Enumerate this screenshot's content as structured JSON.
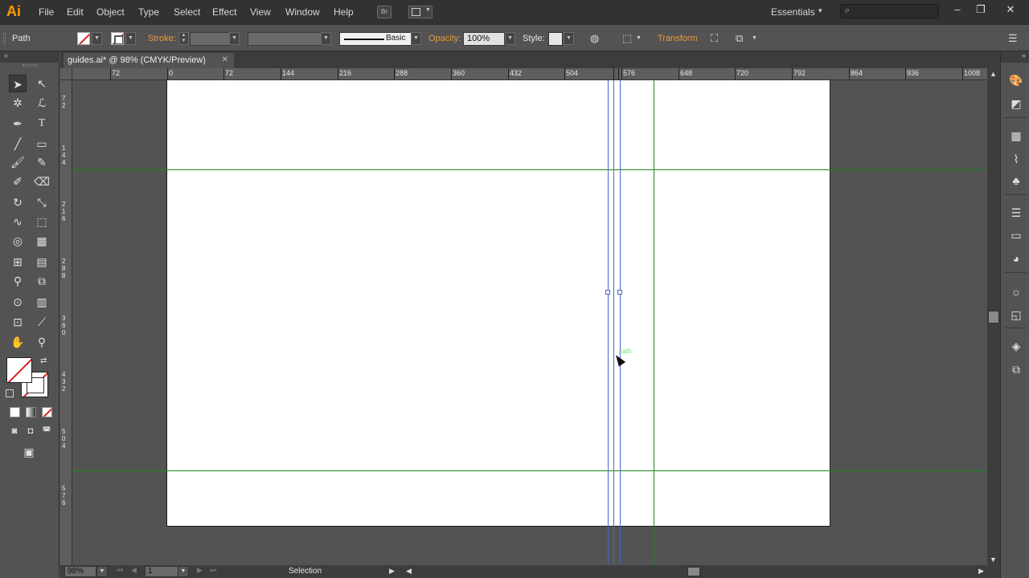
{
  "app": {
    "logo": "Ai",
    "menu": [
      "File",
      "Edit",
      "Object",
      "Type",
      "Select",
      "Effect",
      "View",
      "Window",
      "Help"
    ],
    "bridge_label": "Br",
    "workspace": "Essentials",
    "window_controls": {
      "minimize": "–",
      "restore": "❐",
      "close": "✕"
    }
  },
  "control_bar": {
    "selection_type": "Path",
    "stroke_label": "Stroke:",
    "brush_label": "Basic",
    "opacity_label": "Opacity:",
    "opacity_value": "100%",
    "style_label": "Style:",
    "transform_label": "Transform"
  },
  "document": {
    "tab_title": "guides.ai* @ 98% (CMYK/Preview)",
    "tab_close": "✕"
  },
  "rulers": {
    "horizontal": [
      "72",
      "0",
      "72",
      "144",
      "216",
      "288",
      "360",
      "432",
      "504",
      "576",
      "648",
      "720",
      "792",
      "864",
      "936",
      "1008"
    ],
    "vertical": [
      "7\n2",
      "1\n4\n4",
      "2\n1\n6",
      "2\n8\n8",
      "3\n6\n0",
      "4\n3\n2",
      "5\n0\n4",
      "5\n7\n6"
    ]
  },
  "canvas": {
    "smart_guide_label": "path",
    "guide_color": "#1a8a1a",
    "selection_color": "#4a67c0"
  },
  "status_bar": {
    "zoom": "98%",
    "artboard_number": "1",
    "status_text": "Selection"
  },
  "icons": {
    "search": "search-icon",
    "tools": [
      "selection-tool-icon",
      "direct-selection-tool-icon",
      "magic-wand-icon",
      "lasso-icon",
      "pen-tool-icon",
      "type-tool-icon",
      "line-tool-icon",
      "rectangle-tool-icon",
      "paintbrush-icon",
      "pencil-icon",
      "blob-brush-icon",
      "eraser-icon",
      "rotate-icon",
      "scale-icon",
      "warp-icon",
      "free-transform-icon",
      "shape-builder-icon",
      "perspective-grid-icon",
      "mesh-icon",
      "gradient-icon",
      "eyedropper-icon",
      "blend-icon",
      "symbol-sprayer-icon",
      "column-graph-icon",
      "artboard-tool-icon",
      "slice-icon",
      "hand-tool-icon",
      "zoom-tool-icon"
    ]
  }
}
